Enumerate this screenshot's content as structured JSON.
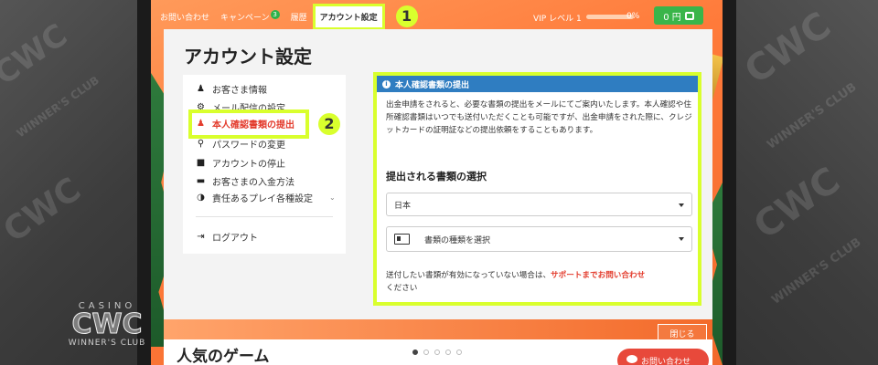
{
  "watermark": {
    "casino": "CASINO",
    "cwc": "CWC",
    "club": "WINNER'S CLUB"
  },
  "nav": {
    "contact": "お問い合わせ",
    "campaign": "キャンペーン",
    "campaign_badge": "3",
    "history": "履歴",
    "account": "アカウント設定",
    "step1": "1",
    "vip_label": "VIP レベル 1",
    "vip_progress": 0,
    "vip_percent": "0%",
    "wallet": "0 円"
  },
  "page": {
    "title": "アカウント設定"
  },
  "menu": {
    "items": [
      {
        "label": "お客さま情報",
        "icon": "user-icon"
      },
      {
        "label": "メール配信の設定",
        "icon": "gear-icon"
      },
      {
        "label": "本人確認書類の提出",
        "icon": "user-id-icon"
      },
      {
        "label": "パスワードの変更",
        "icon": "key-icon"
      },
      {
        "label": "アカウントの停止",
        "icon": "lock-icon"
      },
      {
        "label": "お客さまの入金方法",
        "icon": "card-icon"
      },
      {
        "label": "責任あるプレイ各種設定",
        "icon": "half-circle-icon"
      }
    ],
    "logout": "ログアウト",
    "step2": "2"
  },
  "panel": {
    "header": "本人確認書類の提出",
    "desc": "出金申請をされると、必要な書類の提出をメールにてご案内いたします。本人確認や住所確認書類はいつでも送付いただくことも可能ですが、出金申請をされた際に、クレジットカードの証明証などの提出依頼をすることもあります。",
    "section_title": "提出される書類の選択",
    "country_value": "日本",
    "doc_type_value": "書類の種類を選択",
    "note_before": "送付したい書類が有効になっていない場合は、",
    "note_link": "サポートまでお問い合わせ",
    "note_after": "ください"
  },
  "footer": {
    "close": "閉じる",
    "popular_games": "人気のゲーム",
    "chat": "お問い合わせ"
  },
  "colors": {
    "accent_orange": "#f26a2c",
    "highlight": "#d9ff2d",
    "panel_header": "#2f7dc1",
    "active_red": "#e33d2e",
    "wallet_green": "#3ab54a"
  }
}
